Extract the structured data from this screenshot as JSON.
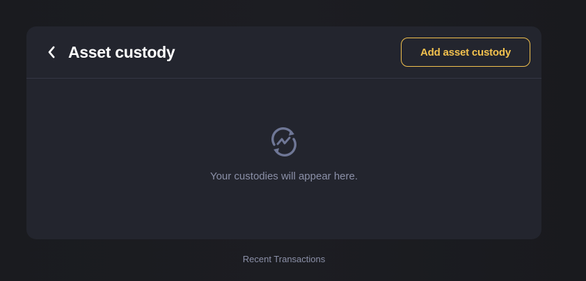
{
  "header": {
    "title": "Asset custody",
    "back_icon": "chevron-left-icon",
    "add_button_label": "Add asset custody"
  },
  "empty_state": {
    "icon": "exchange-cycle-icon",
    "message": "Your custodies will appear here."
  },
  "footer": {
    "recent_transactions_label": "Recent Transactions"
  },
  "colors": {
    "background": "#1c1d22",
    "card": "#23252e",
    "accent": "#f2c14e",
    "muted_text": "#8b90a8",
    "icon": "#6f7796"
  }
}
